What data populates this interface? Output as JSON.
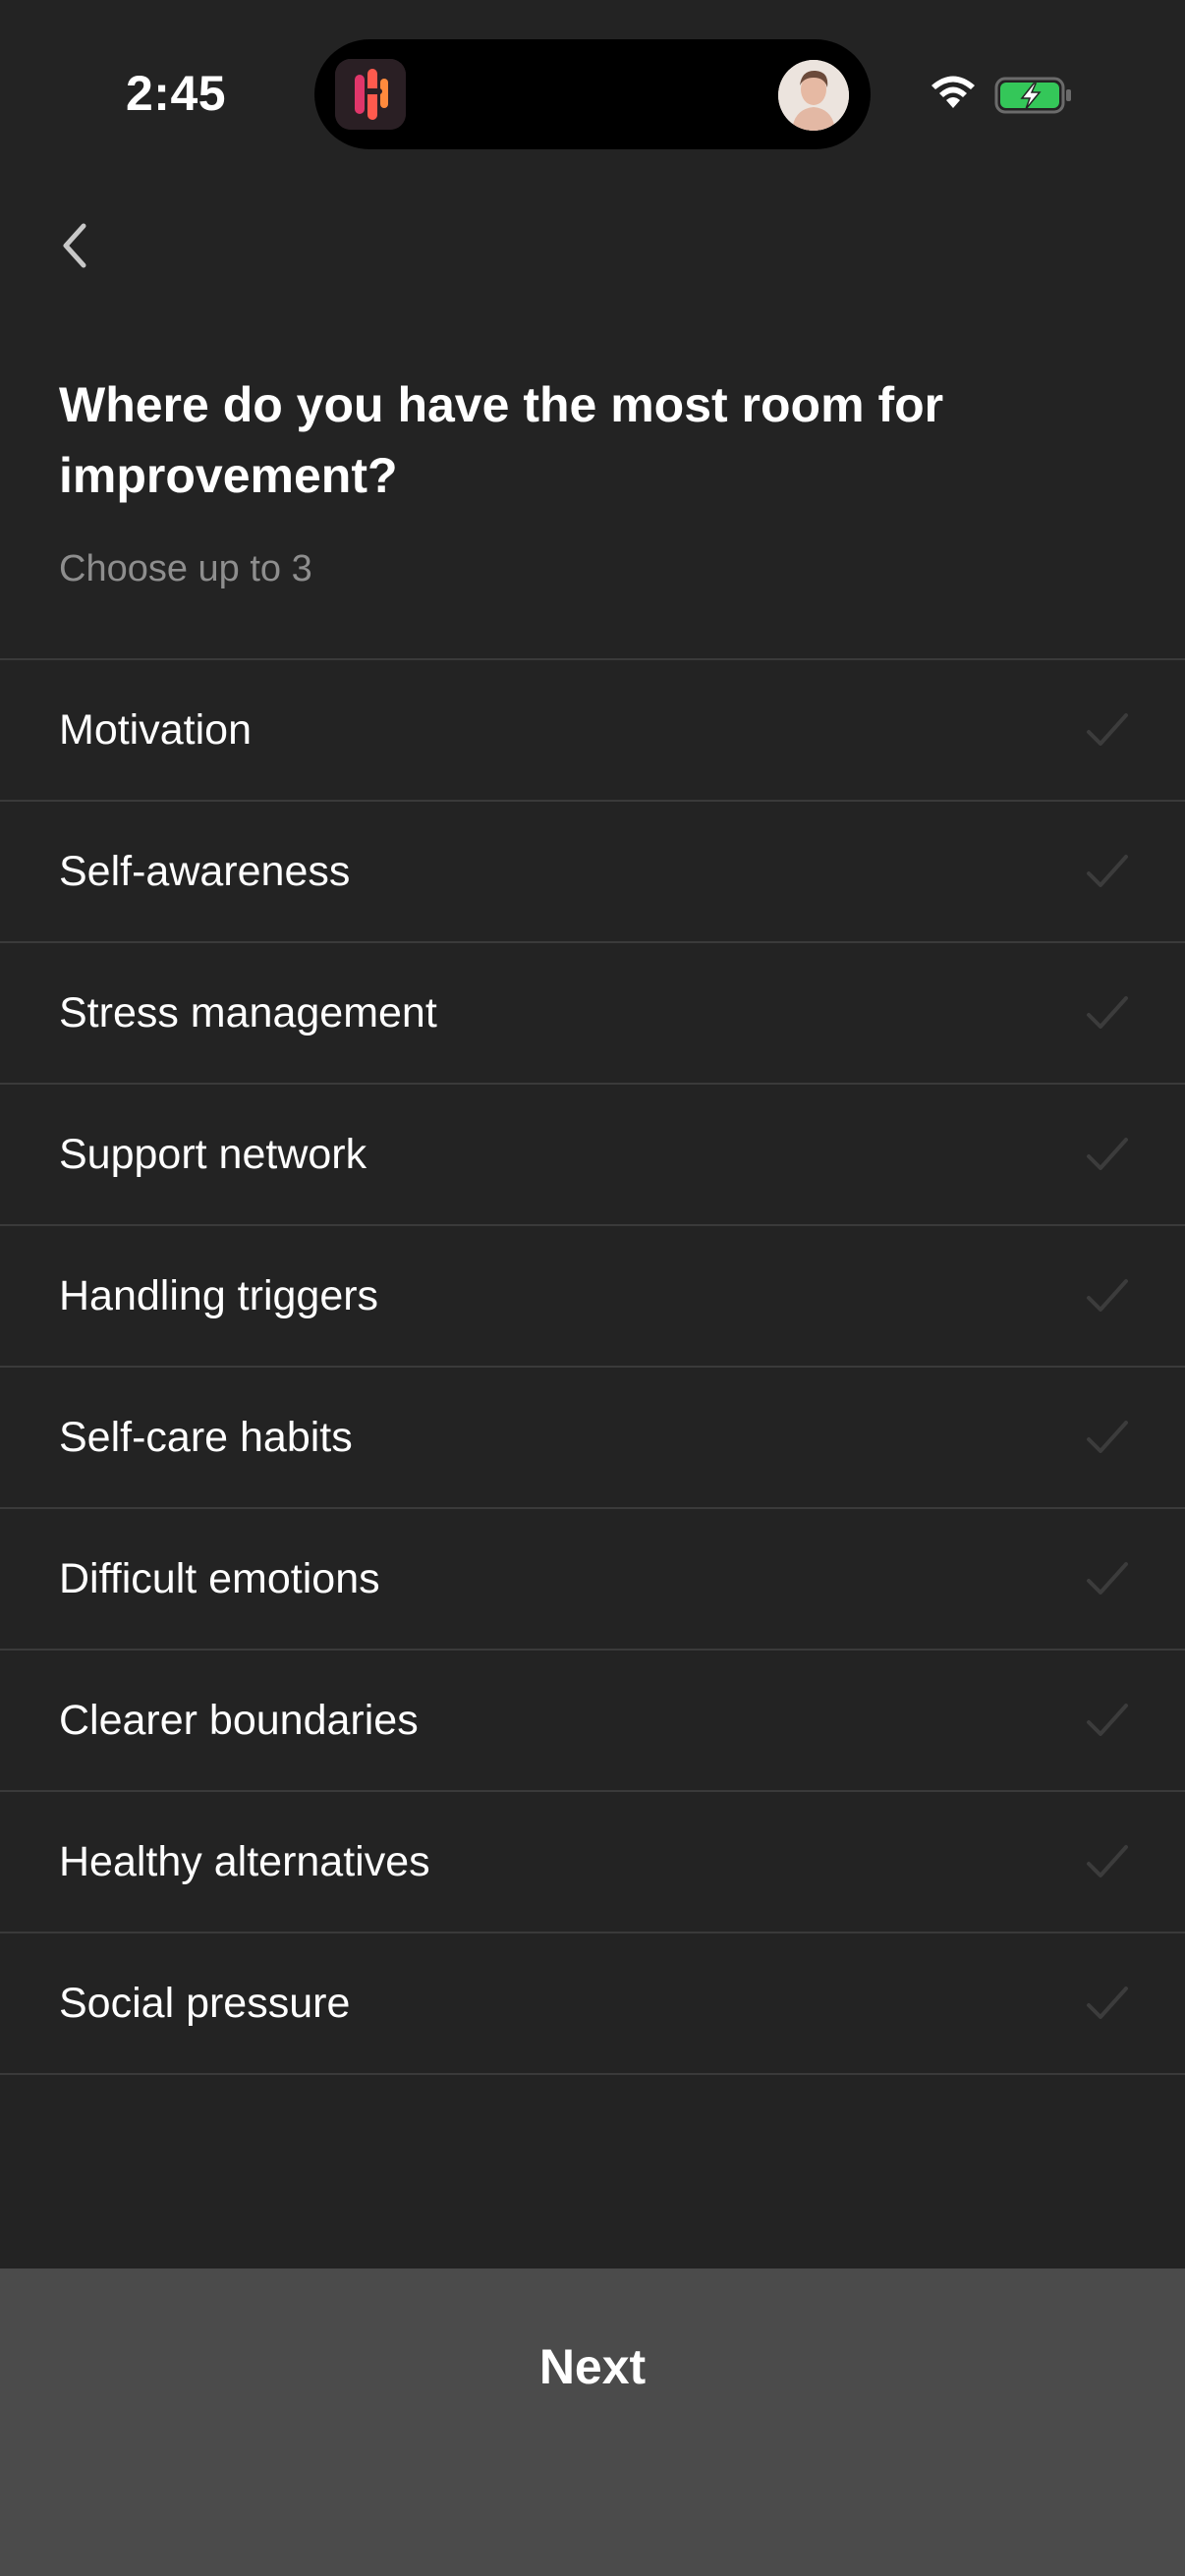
{
  "status_bar": {
    "time": "2:45",
    "battery_color": "#34c759"
  },
  "header": {
    "title": "Where do you have the most room for improvement?",
    "subtitle": "Choose up to 3"
  },
  "options": [
    {
      "label": "Motivation",
      "selected": false
    },
    {
      "label": "Self-awareness",
      "selected": false
    },
    {
      "label": "Stress management",
      "selected": false
    },
    {
      "label": "Support network",
      "selected": false
    },
    {
      "label": "Handling triggers",
      "selected": false
    },
    {
      "label": "Self-care habits",
      "selected": false
    },
    {
      "label": "Difficult emotions",
      "selected": false
    },
    {
      "label": "Clearer boundaries",
      "selected": false
    },
    {
      "label": "Healthy alternatives",
      "selected": false
    },
    {
      "label": "Social pressure",
      "selected": false
    }
  ],
  "footer": {
    "next_label": "Next"
  },
  "icons": {
    "back": "chevron-left-icon",
    "check": "checkmark-icon",
    "wifi": "wifi-icon",
    "battery": "battery-charging-icon"
  }
}
